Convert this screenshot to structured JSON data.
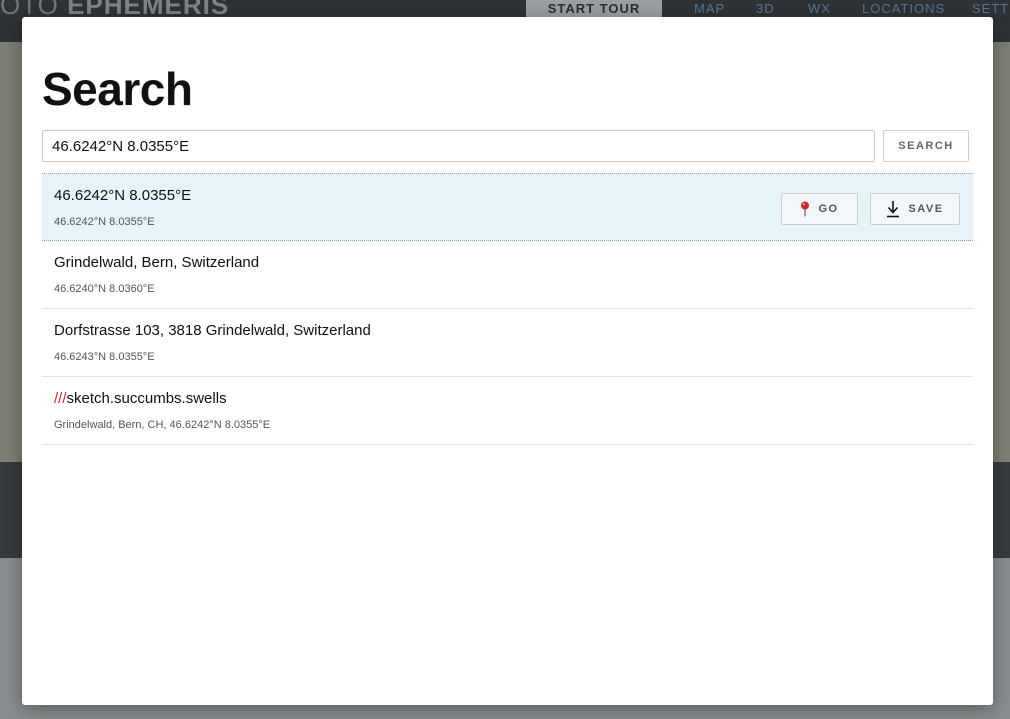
{
  "background": {
    "logo_prefix": "OTO",
    "logo_main": "EPHEMERIS",
    "start_tour": "START TOUR",
    "nav": [
      "MAP",
      "3D",
      "WX",
      "LOCATIONS",
      "SETTI"
    ]
  },
  "dialog": {
    "title": "Search",
    "search": {
      "value": "46.6242°N 8.0355°E",
      "button_label": "SEARCH"
    },
    "results": [
      {
        "title": "46.6242°N 8.0355°E",
        "subtitle": "46.6242°N 8.0355°E",
        "selected": true
      },
      {
        "title": "Grindelwald, Bern, Switzerland",
        "subtitle": "46.6240°N 8.0360°E"
      },
      {
        "title": "Dorfstrasse 103, 3818 Grindelwald, Switzerland",
        "subtitle": "46.6243°N 8.0355°E"
      },
      {
        "title_prefix": "///",
        "title": "sketch.succumbs.swells",
        "subtitle": "Grindelwald, Bern, CH, 46.6242°N 8.0355°E"
      }
    ],
    "actions": {
      "go_label": "GO",
      "save_label": "SAVE"
    }
  },
  "colors": {
    "selected_row": "#e6f3f9",
    "w3w_red": "#e11f26",
    "pin_red": "#c62828"
  },
  "icons": {
    "go": "map-pin-icon",
    "save": "download-icon"
  }
}
